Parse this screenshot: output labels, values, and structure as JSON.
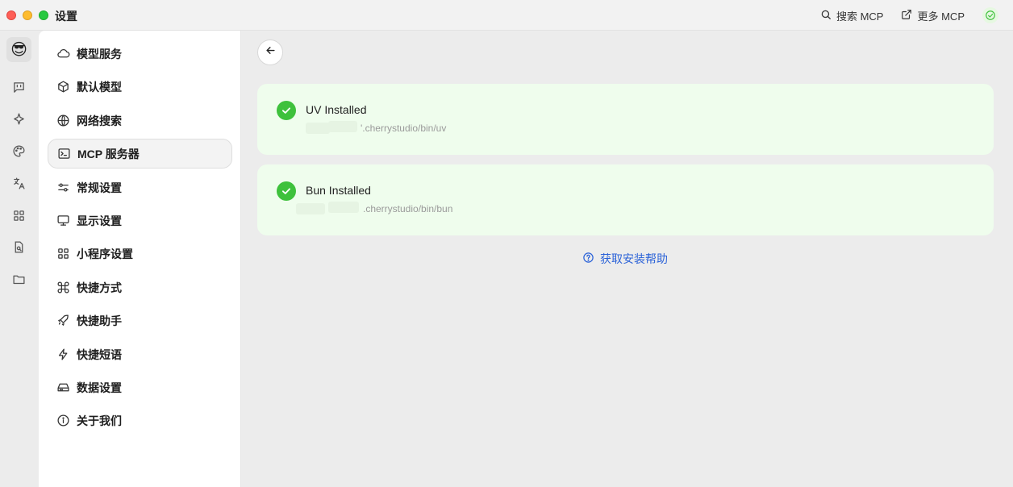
{
  "window": {
    "title": "设置"
  },
  "titlebar": {
    "search_mcp": "搜索 MCP",
    "more_mcp": "更多 MCP",
    "status_icon": "check-circle-icon"
  },
  "iconbar": {
    "avatar": "😎",
    "icons": [
      "chat-icon",
      "sparkle-icon",
      "palette-icon",
      "translate-icon",
      "apps-icon",
      "file-search-icon",
      "folder-icon"
    ]
  },
  "menu": {
    "items": [
      {
        "label": "模型服务",
        "icon": "cloud-icon"
      },
      {
        "label": "默认模型",
        "icon": "cube-icon"
      },
      {
        "label": "网络搜索",
        "icon": "globe-icon"
      },
      {
        "label": "MCP 服务器",
        "icon": "terminal-icon",
        "active": true
      },
      {
        "label": "常规设置",
        "icon": "sliders-icon"
      },
      {
        "label": "显示设置",
        "icon": "monitor-icon"
      },
      {
        "label": "小程序设置",
        "icon": "grid-icon"
      },
      {
        "label": "快捷方式",
        "icon": "command-icon"
      },
      {
        "label": "快捷助手",
        "icon": "rocket-icon"
      },
      {
        "label": "快捷短语",
        "icon": "zap-icon"
      },
      {
        "label": "数据设置",
        "icon": "hard-drive-icon"
      },
      {
        "label": "关于我们",
        "icon": "info-icon"
      }
    ]
  },
  "main": {
    "cards": [
      {
        "title": "UV Installed",
        "path": "'.cherrystudio/bin/uv"
      },
      {
        "title": "Bun Installed",
        "path": ".cherrystudio/bin/bun"
      }
    ],
    "help_link": "获取安装帮助"
  },
  "colors": {
    "accent_green": "#3ec13c",
    "card_bg": "#effded",
    "link_blue": "#2c63d8"
  }
}
